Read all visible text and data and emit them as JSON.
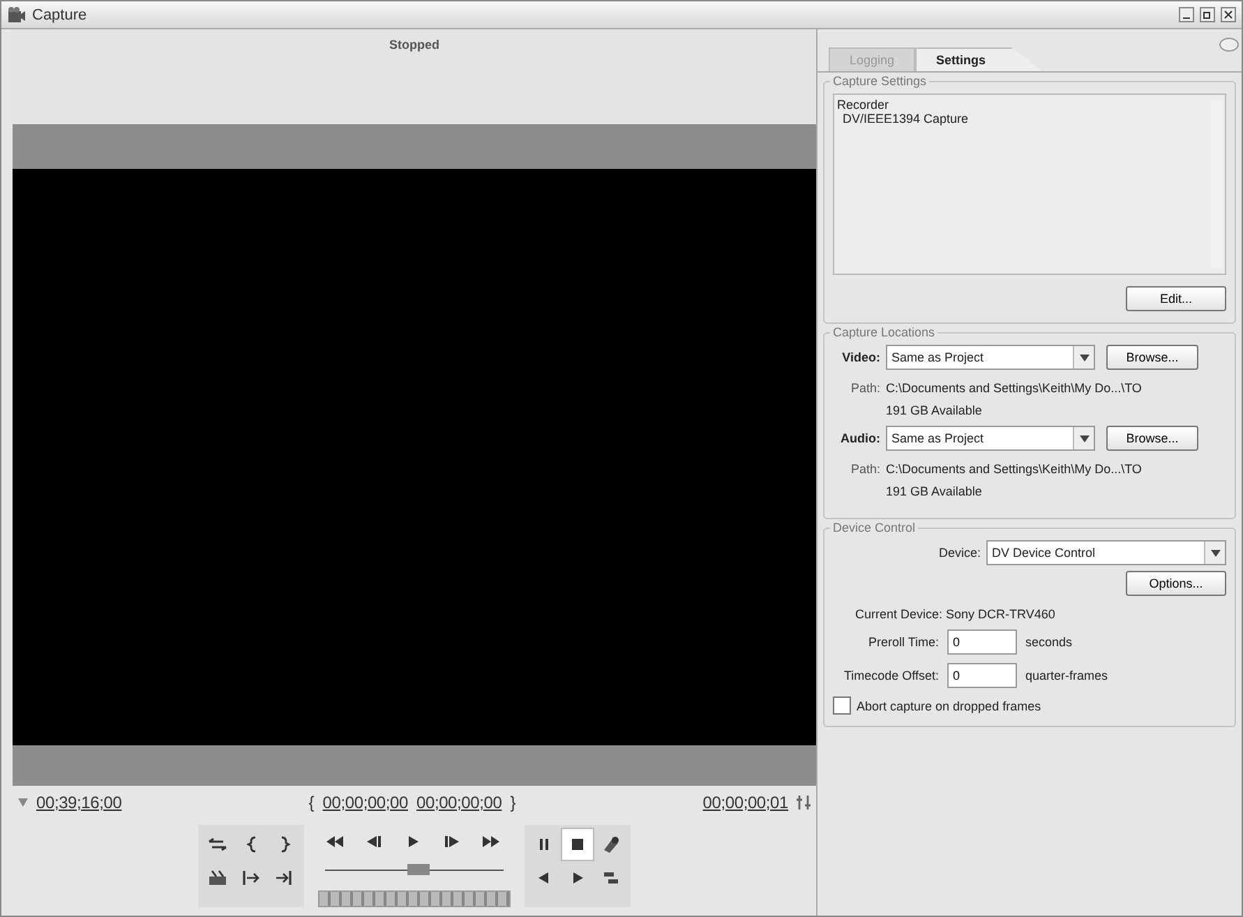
{
  "window": {
    "title": "Capture"
  },
  "monitor": {
    "status": "Stopped"
  },
  "timecodes": {
    "current": "00;39;16;00",
    "in_mark": "{",
    "in": "00;00;00;00",
    "out": "00;00;00;00",
    "out_mark": "}",
    "duration": "00;00;00;01"
  },
  "transport_row_1": [
    {
      "kind": "swap",
      "selected": false
    },
    {
      "kind": "mark-in",
      "selected": false
    },
    {
      "kind": "mark-out",
      "selected": false
    },
    {
      "kind": "rewind",
      "selected": false
    },
    {
      "kind": "step-back",
      "selected": false
    },
    {
      "kind": "play",
      "selected": false
    },
    {
      "kind": "step-forward",
      "selected": false
    },
    {
      "kind": "fast-forward",
      "selected": false
    },
    {
      "kind": "pause",
      "selected": false
    },
    {
      "kind": "stop",
      "selected": true
    },
    {
      "kind": "record",
      "selected": false
    }
  ],
  "transport_row_2": [
    {
      "kind": "scene",
      "selected": false
    },
    {
      "kind": "goto-in",
      "selected": false
    },
    {
      "kind": "goto-out",
      "selected": false
    },
    {
      "kind": "slow-reverse",
      "selected": false
    },
    {
      "kind": "slow-play",
      "selected": false
    },
    {
      "kind": "scene-search",
      "selected": false
    }
  ],
  "shuttle": {
    "level": 0.52
  },
  "tabs": [
    {
      "label": "Logging",
      "selected": false
    },
    {
      "label": "Settings",
      "selected": true
    }
  ],
  "capture_settings": {
    "title": "Capture Settings",
    "lines": [
      "Recorder",
      "DV/IEEE1394 Capture"
    ],
    "button": "Edit..."
  },
  "capture_locations": {
    "title": "Capture Locations",
    "entries": [
      {
        "label": "Video:",
        "value": "Same as Project",
        "button": "Browse...",
        "path_label": "Path:",
        "path": "C:\\Documents and Settings\\Keith\\My Do...\\TO",
        "available": "191 GB Available"
      },
      {
        "label": "Audio:",
        "value": "Same as Project",
        "button": "Browse...",
        "path_label": "Path:",
        "path": "C:\\Documents and Settings\\Keith\\My Do...\\TO",
        "available": "191 GB Available"
      }
    ]
  },
  "device_control": {
    "title": "Device Control",
    "device_label": "Device:",
    "device": "DV Device Control",
    "button": "Options...",
    "current_device": "Current Device: Sony DCR-TRV460",
    "fields": [
      {
        "label": "Preroll Time:",
        "value": "0",
        "unit": "seconds"
      },
      {
        "label": "Timecode Offset:",
        "value": "0",
        "unit": "quarter-frames"
      }
    ],
    "abort": {
      "label": "Abort capture on dropped frames",
      "checked": false
    }
  }
}
